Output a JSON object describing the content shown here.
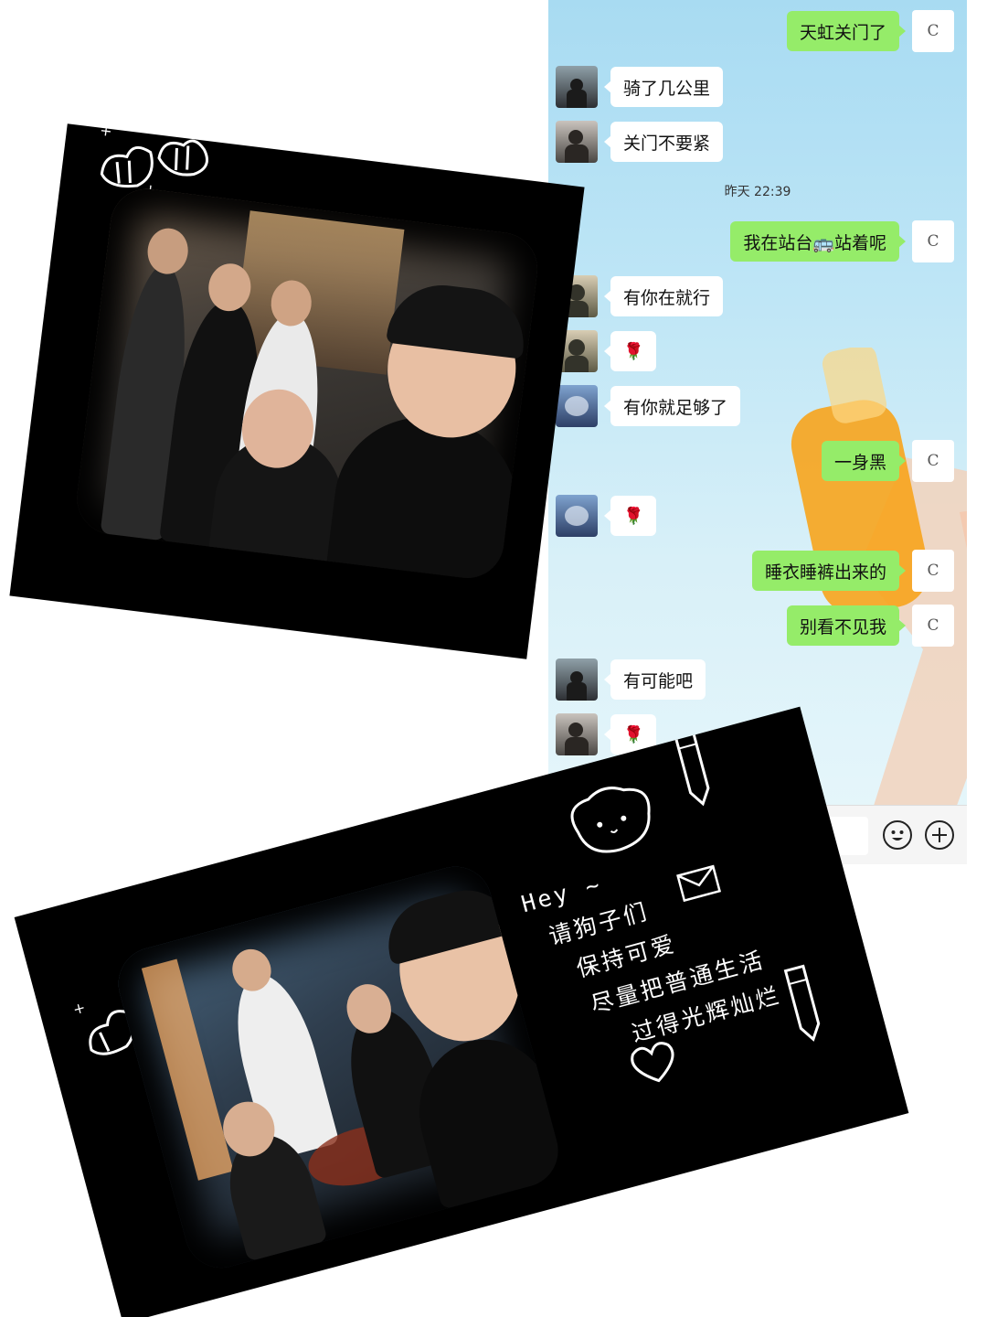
{
  "chat": {
    "background_color": "#bfe6f6",
    "self_bubble_color": "#95ec69",
    "other_bubble_color": "#ffffff",
    "timestamp": "昨天 22:39",
    "self_avatar_glyph": "C",
    "messages": [
      {
        "side": "right",
        "text": "天虹关门了"
      },
      {
        "side": "left",
        "text": "骑了几公里"
      },
      {
        "side": "left",
        "text": "关门不要紧"
      },
      {
        "side": "right",
        "text": "我在站台🚌站着呢"
      },
      {
        "side": "left",
        "text": "有你在就行"
      },
      {
        "side": "left",
        "text": "🌹"
      },
      {
        "side": "left",
        "text": "有你就足够了"
      },
      {
        "side": "right",
        "text": "一身黑"
      },
      {
        "side": "left",
        "text": "🌹"
      },
      {
        "side": "right",
        "text": "睡衣睡裤出来的"
      },
      {
        "side": "right",
        "text": "别看不见我"
      },
      {
        "side": "left",
        "text": "有可能吧"
      },
      {
        "side": "left",
        "text": "🌹"
      }
    ],
    "input_bar": {
      "emoji_icon": "smile-icon",
      "plus_icon": "plus-icon"
    }
  },
  "cards": {
    "top": {
      "decoration": "cloud-doodle"
    },
    "bottom": {
      "caption_lines": [
        "Hey ~",
        "请狗子们",
        "保持可爱",
        "尽量把普通生活",
        "过得光辉灿烂"
      ],
      "decorations": [
        "puppy-doodle",
        "pencil-icon",
        "envelope-icon",
        "heart-doodle"
      ]
    }
  }
}
